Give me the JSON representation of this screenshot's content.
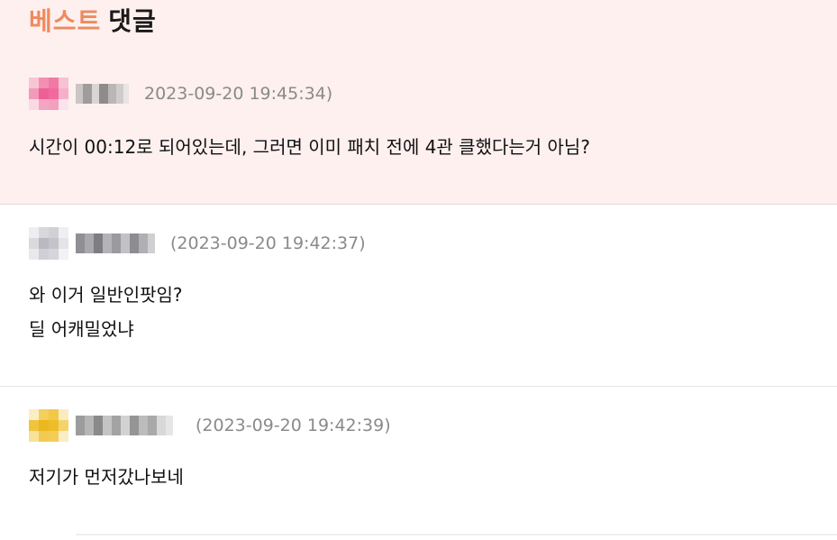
{
  "header": {
    "best_word": "베스트",
    "comment_word": "댓글"
  },
  "colors": {
    "best_bg": "#fdf0ef",
    "title_accent": "#f08a5d",
    "date_gray": "#8a8a8a"
  },
  "comments": [
    {
      "date": "2023-09-20 19:45:34)",
      "text": "시간이 00:12로 되어있는데, 그러면 이미 패치 전에 4관 클했다는거 아님?",
      "avatar": "pixelated-pink-avatar",
      "nickname": "pixelated-nickname"
    },
    {
      "date": "(2023-09-20 19:42:37)",
      "text": "와 이거 일반인팟임?\n딜 어캐밀었냐",
      "avatar": "pixelated-gray-avatar",
      "nickname": "pixelated-nickname"
    },
    {
      "date": "(2023-09-20 19:42:39)",
      "text": "저기가 먼저갔나보네",
      "avatar": "pixelated-yellow-avatar",
      "nickname": "pixelated-nickname"
    }
  ]
}
